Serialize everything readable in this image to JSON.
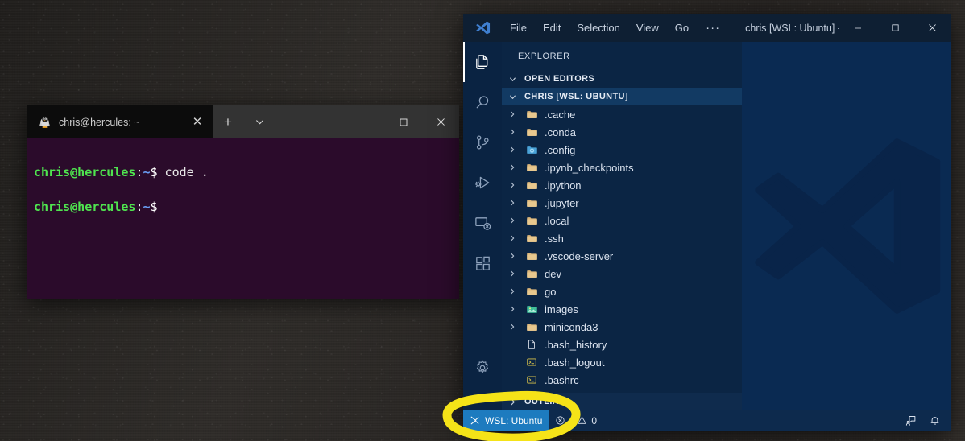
{
  "desktop": {
    "name": "windows-desktop-wallpaper"
  },
  "terminal": {
    "tab": {
      "title": "chris@hercules: ~",
      "icon": "ubuntu-tux-icon",
      "close_label": "✕"
    },
    "new_tab_label": "+",
    "dropdown_label": "⌄",
    "window_controls": {
      "minimize": "—",
      "maximize": "☐",
      "close": "✕"
    },
    "lines": [
      {
        "user": "chris@hercules",
        "sep": ":",
        "path": "~",
        "dollar": "$",
        "command": " code ."
      },
      {
        "user": "chris@hercules",
        "sep": ":",
        "path": "~",
        "dollar": "$",
        "command": ""
      }
    ]
  },
  "vscode": {
    "titlebar": {
      "logo": "vscode-logo-icon",
      "menus": [
        "File",
        "Edit",
        "Selection",
        "View",
        "Go"
      ],
      "overflow_label": "···",
      "window_title": "chris [WSL: Ubuntu] - Visu...",
      "controls": {
        "minimize": "—",
        "maximize": "☐",
        "close": "✕"
      }
    },
    "activitybar": [
      {
        "name": "explorer",
        "icon": "files-icon",
        "active": true
      },
      {
        "name": "search",
        "icon": "search-icon",
        "active": false
      },
      {
        "name": "source-control",
        "icon": "source-control-icon",
        "active": false
      },
      {
        "name": "run-and-debug",
        "icon": "run-debug-icon",
        "active": false
      },
      {
        "name": "remote-explorer",
        "icon": "remote-explorer-icon",
        "active": false
      },
      {
        "name": "extensions",
        "icon": "extensions-icon",
        "active": false
      },
      {
        "name": "manage",
        "icon": "gear-icon",
        "active": false
      }
    ],
    "sidebar": {
      "title": "EXPLORER",
      "open_editors": {
        "label": "OPEN EDITORS",
        "expanded": true
      },
      "folder": {
        "label": "CHRIS [WSL: UBUNTU]",
        "expanded": true
      },
      "outline": {
        "label": "OUTLINE",
        "expanded": false
      },
      "tree": [
        {
          "name": ".cache",
          "type": "folder",
          "icon": "folder-icon",
          "expandable": true
        },
        {
          "name": ".conda",
          "type": "folder",
          "icon": "folder-icon",
          "expandable": true
        },
        {
          "name": ".config",
          "type": "folder",
          "icon": "config-folder-icon",
          "expandable": true
        },
        {
          "name": ".ipynb_checkpoints",
          "type": "folder",
          "icon": "folder-icon",
          "expandable": true
        },
        {
          "name": ".ipython",
          "type": "folder",
          "icon": "folder-icon",
          "expandable": true
        },
        {
          "name": ".jupyter",
          "type": "folder",
          "icon": "folder-icon",
          "expandable": true
        },
        {
          "name": ".local",
          "type": "folder",
          "icon": "folder-icon",
          "expandable": true
        },
        {
          "name": ".ssh",
          "type": "folder",
          "icon": "folder-icon",
          "expandable": true
        },
        {
          "name": ".vscode-server",
          "type": "folder",
          "icon": "folder-icon",
          "expandable": true
        },
        {
          "name": "dev",
          "type": "folder",
          "icon": "folder-icon",
          "expandable": true
        },
        {
          "name": "go",
          "type": "folder",
          "icon": "folder-icon",
          "expandable": true
        },
        {
          "name": "images",
          "type": "folder",
          "icon": "images-folder-icon",
          "expandable": true
        },
        {
          "name": "miniconda3",
          "type": "folder",
          "icon": "folder-icon",
          "expandable": true
        },
        {
          "name": ".bash_history",
          "type": "file",
          "icon": "file-icon",
          "expandable": false
        },
        {
          "name": ".bash_logout",
          "type": "file",
          "icon": "console-file-icon",
          "expandable": false
        },
        {
          "name": ".bashrc",
          "type": "file",
          "icon": "console-file-icon",
          "expandable": false
        }
      ]
    },
    "editor": {
      "watermark": "vscode-logo-watermark"
    },
    "statusbar": {
      "remote": {
        "label": "WSL: Ubuntu",
        "icon": "remote-indicator-icon"
      },
      "errors": {
        "icon": "error-icon",
        "count": ""
      },
      "warnings": {
        "icon": "warning-icon",
        "count": "0"
      },
      "right": [
        {
          "name": "feedback",
          "icon": "feedback-icon"
        },
        {
          "name": "notifications",
          "icon": "bell-icon"
        }
      ]
    }
  },
  "annotation": {
    "name": "yellow-highlight-ellipse",
    "color": "#f5e318",
    "target": "WSL: Ubuntu status bar item"
  },
  "colors": {
    "remote_badge": "#1d7bbf",
    "statusbar": "#0d2a4d",
    "sidebar": "#0b2544",
    "editor": "#0a2a52",
    "activitybar": "#0a2342",
    "titlebar": "#0e1f33",
    "terminal_bg": "#2b0b2b",
    "annotation": "#f5e318"
  }
}
